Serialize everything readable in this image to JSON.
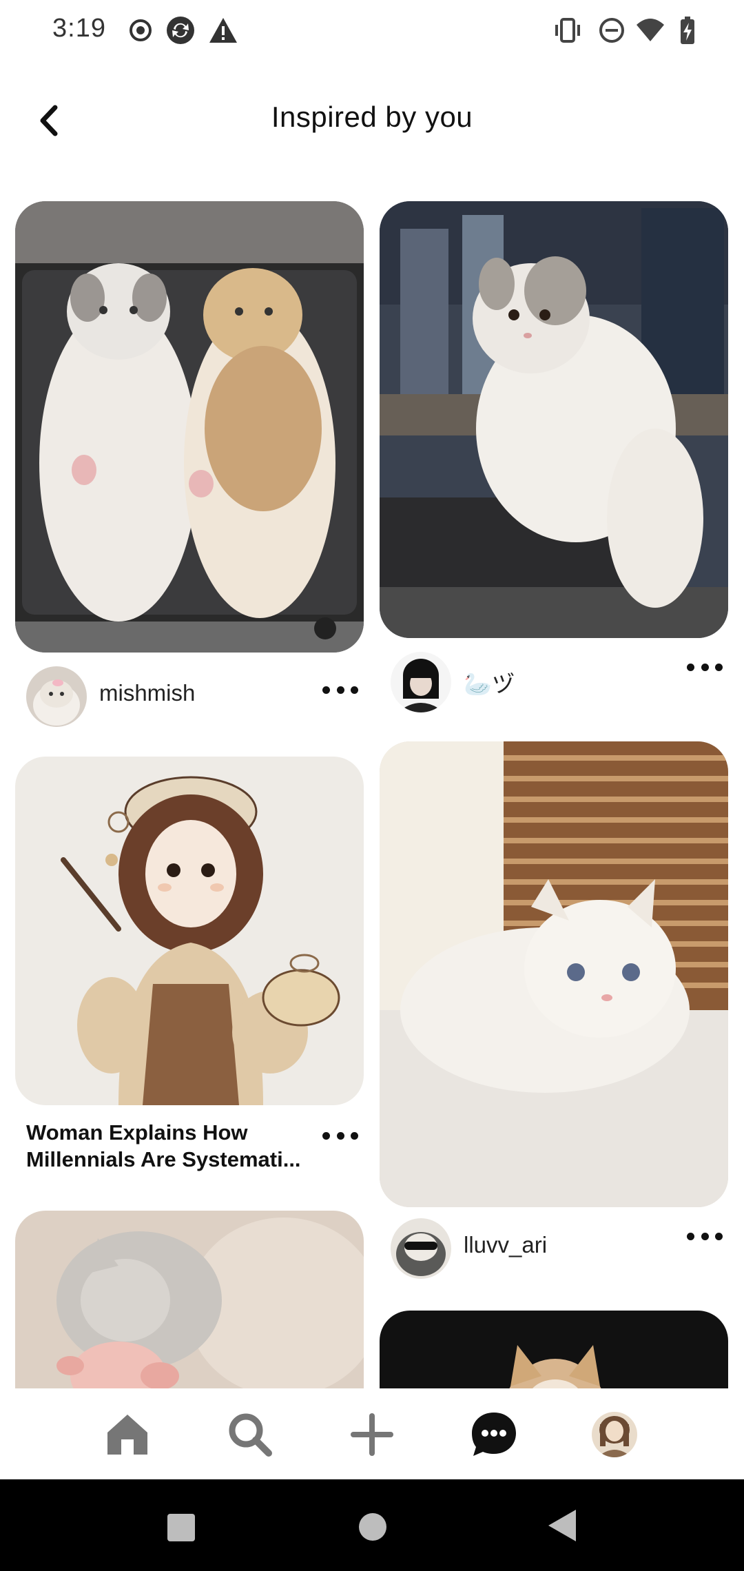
{
  "status_bar": {
    "time": "3:19",
    "left_icons": [
      "record-icon",
      "sync-icon",
      "warning-icon"
    ],
    "right_icons": [
      "vibrate-icon",
      "do-not-disturb-icon",
      "wifi-icon",
      "battery-charging-icon"
    ]
  },
  "header": {
    "back_icon": "chevron-left-icon",
    "title": "Inspired by you"
  },
  "pins": [
    {
      "id": "pin-1",
      "image": "two cats lying in open suitcase",
      "author": "mishmish",
      "title": ""
    },
    {
      "id": "pin-2",
      "image": "fluffy white and grey cat sitting on ledge at night",
      "author": "🦢ヅ",
      "title": ""
    },
    {
      "id": "pin-3",
      "image": "illustration of girl with beret holding paintbrush",
      "author": "",
      "title": "Woman Explains How Millennials Are Systemati..."
    },
    {
      "id": "pin-4",
      "image": "white fluffy kitten lying on blanket by window blinds",
      "author": "lluvv_ari",
      "title": ""
    },
    {
      "id": "pin-5",
      "image": "grey cat sleeping with pig plush",
      "author": "",
      "title": ""
    },
    {
      "id": "pin-6",
      "image": "cat on dark background",
      "author": "",
      "title": ""
    }
  ],
  "bottom_nav": {
    "items": [
      "home-icon",
      "search-icon",
      "create-icon",
      "messages-icon",
      "profile-avatar"
    ]
  },
  "system_nav": {
    "items": [
      "recents-button",
      "home-button",
      "back-button"
    ]
  },
  "colors": {
    "text": "#111111",
    "background": "#ffffff",
    "nav_icon": "#767676",
    "system_bar": "#000000"
  }
}
